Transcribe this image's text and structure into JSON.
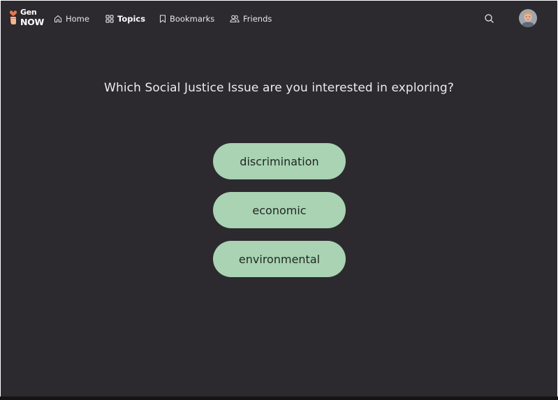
{
  "app": {
    "logo_top": "Gen",
    "logo_bottom": "NOW"
  },
  "nav": {
    "items": [
      {
        "label": "Home",
        "icon": "home-icon",
        "active": false
      },
      {
        "label": "Topics",
        "icon": "grid-icon",
        "active": true
      },
      {
        "label": "Bookmarks",
        "icon": "bookmark-icon",
        "active": false
      },
      {
        "label": "Friends",
        "icon": "friends-icon",
        "active": false
      }
    ]
  },
  "header": {
    "search_icon": "search-icon",
    "avatar_icon": "user-avatar"
  },
  "main": {
    "question": "Which Social Justice Issue are you interested in exploring?",
    "options": [
      "discrimination",
      "economic",
      "environmental"
    ]
  },
  "colors": {
    "background": "#2c2a2f",
    "option_fill": "#a9d3b3",
    "logo_accent": "#e8784f",
    "text": "#ececec"
  }
}
